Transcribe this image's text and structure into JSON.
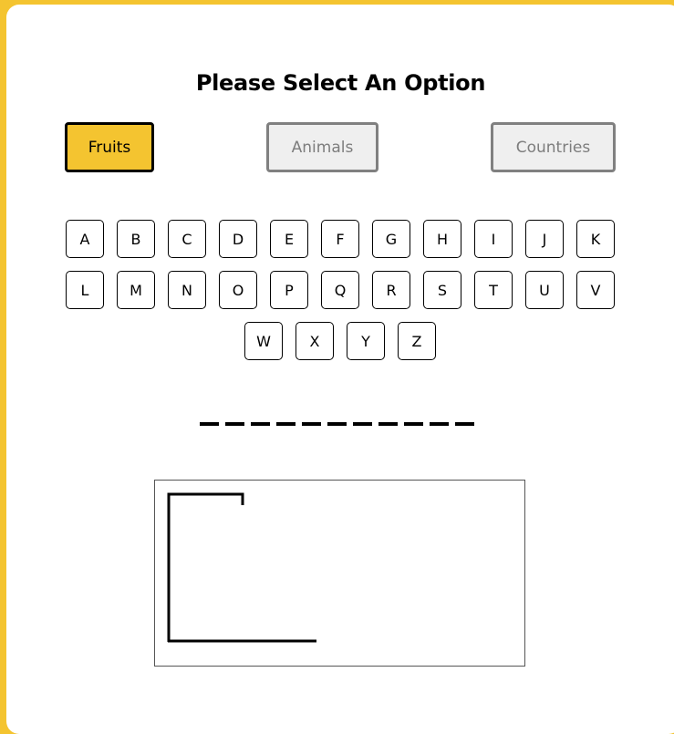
{
  "title": "Please Select An Option",
  "options": [
    {
      "label": "Fruits",
      "selected": true
    },
    {
      "label": "Animals",
      "selected": false
    },
    {
      "label": "Countries",
      "selected": false
    }
  ],
  "letters": [
    "A",
    "B",
    "C",
    "D",
    "E",
    "F",
    "G",
    "H",
    "I",
    "J",
    "K",
    "L",
    "M",
    "N",
    "O",
    "P",
    "Q",
    "R",
    "S",
    "T",
    "U",
    "V",
    "W",
    "X",
    "Y",
    "Z"
  ],
  "word_blanks": 11,
  "colors": {
    "accent": "#f4c430",
    "inactive_bg": "#efefef",
    "inactive_border": "#808080"
  }
}
